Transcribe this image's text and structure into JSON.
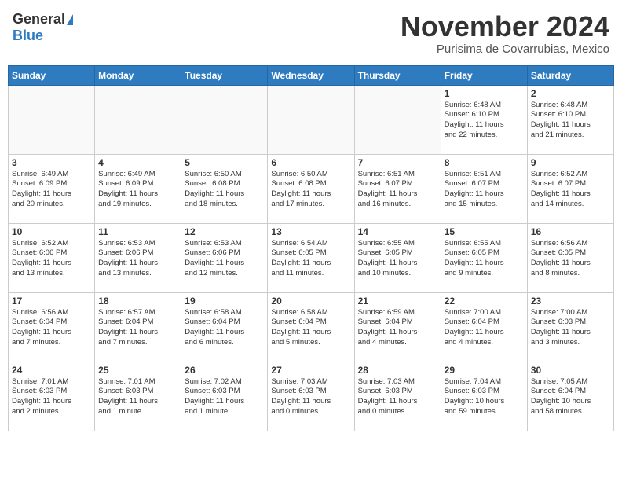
{
  "header": {
    "logo_general": "General",
    "logo_blue": "Blue",
    "title": "November 2024",
    "location": "Purisima de Covarrubias, Mexico"
  },
  "weekdays": [
    "Sunday",
    "Monday",
    "Tuesday",
    "Wednesday",
    "Thursday",
    "Friday",
    "Saturday"
  ],
  "weeks": [
    [
      {
        "day": "",
        "info": ""
      },
      {
        "day": "",
        "info": ""
      },
      {
        "day": "",
        "info": ""
      },
      {
        "day": "",
        "info": ""
      },
      {
        "day": "",
        "info": ""
      },
      {
        "day": "1",
        "info": "Sunrise: 6:48 AM\nSunset: 6:10 PM\nDaylight: 11 hours\nand 22 minutes."
      },
      {
        "day": "2",
        "info": "Sunrise: 6:48 AM\nSunset: 6:10 PM\nDaylight: 11 hours\nand 21 minutes."
      }
    ],
    [
      {
        "day": "3",
        "info": "Sunrise: 6:49 AM\nSunset: 6:09 PM\nDaylight: 11 hours\nand 20 minutes."
      },
      {
        "day": "4",
        "info": "Sunrise: 6:49 AM\nSunset: 6:09 PM\nDaylight: 11 hours\nand 19 minutes."
      },
      {
        "day": "5",
        "info": "Sunrise: 6:50 AM\nSunset: 6:08 PM\nDaylight: 11 hours\nand 18 minutes."
      },
      {
        "day": "6",
        "info": "Sunrise: 6:50 AM\nSunset: 6:08 PM\nDaylight: 11 hours\nand 17 minutes."
      },
      {
        "day": "7",
        "info": "Sunrise: 6:51 AM\nSunset: 6:07 PM\nDaylight: 11 hours\nand 16 minutes."
      },
      {
        "day": "8",
        "info": "Sunrise: 6:51 AM\nSunset: 6:07 PM\nDaylight: 11 hours\nand 15 minutes."
      },
      {
        "day": "9",
        "info": "Sunrise: 6:52 AM\nSunset: 6:07 PM\nDaylight: 11 hours\nand 14 minutes."
      }
    ],
    [
      {
        "day": "10",
        "info": "Sunrise: 6:52 AM\nSunset: 6:06 PM\nDaylight: 11 hours\nand 13 minutes."
      },
      {
        "day": "11",
        "info": "Sunrise: 6:53 AM\nSunset: 6:06 PM\nDaylight: 11 hours\nand 13 minutes."
      },
      {
        "day": "12",
        "info": "Sunrise: 6:53 AM\nSunset: 6:06 PM\nDaylight: 11 hours\nand 12 minutes."
      },
      {
        "day": "13",
        "info": "Sunrise: 6:54 AM\nSunset: 6:05 PM\nDaylight: 11 hours\nand 11 minutes."
      },
      {
        "day": "14",
        "info": "Sunrise: 6:55 AM\nSunset: 6:05 PM\nDaylight: 11 hours\nand 10 minutes."
      },
      {
        "day": "15",
        "info": "Sunrise: 6:55 AM\nSunset: 6:05 PM\nDaylight: 11 hours\nand 9 minutes."
      },
      {
        "day": "16",
        "info": "Sunrise: 6:56 AM\nSunset: 6:05 PM\nDaylight: 11 hours\nand 8 minutes."
      }
    ],
    [
      {
        "day": "17",
        "info": "Sunrise: 6:56 AM\nSunset: 6:04 PM\nDaylight: 11 hours\nand 7 minutes."
      },
      {
        "day": "18",
        "info": "Sunrise: 6:57 AM\nSunset: 6:04 PM\nDaylight: 11 hours\nand 7 minutes."
      },
      {
        "day": "19",
        "info": "Sunrise: 6:58 AM\nSunset: 6:04 PM\nDaylight: 11 hours\nand 6 minutes."
      },
      {
        "day": "20",
        "info": "Sunrise: 6:58 AM\nSunset: 6:04 PM\nDaylight: 11 hours\nand 5 minutes."
      },
      {
        "day": "21",
        "info": "Sunrise: 6:59 AM\nSunset: 6:04 PM\nDaylight: 11 hours\nand 4 minutes."
      },
      {
        "day": "22",
        "info": "Sunrise: 7:00 AM\nSunset: 6:04 PM\nDaylight: 11 hours\nand 4 minutes."
      },
      {
        "day": "23",
        "info": "Sunrise: 7:00 AM\nSunset: 6:03 PM\nDaylight: 11 hours\nand 3 minutes."
      }
    ],
    [
      {
        "day": "24",
        "info": "Sunrise: 7:01 AM\nSunset: 6:03 PM\nDaylight: 11 hours\nand 2 minutes."
      },
      {
        "day": "25",
        "info": "Sunrise: 7:01 AM\nSunset: 6:03 PM\nDaylight: 11 hours\nand 1 minute."
      },
      {
        "day": "26",
        "info": "Sunrise: 7:02 AM\nSunset: 6:03 PM\nDaylight: 11 hours\nand 1 minute."
      },
      {
        "day": "27",
        "info": "Sunrise: 7:03 AM\nSunset: 6:03 PM\nDaylight: 11 hours\nand 0 minutes."
      },
      {
        "day": "28",
        "info": "Sunrise: 7:03 AM\nSunset: 6:03 PM\nDaylight: 11 hours\nand 0 minutes."
      },
      {
        "day": "29",
        "info": "Sunrise: 7:04 AM\nSunset: 6:03 PM\nDaylight: 10 hours\nand 59 minutes."
      },
      {
        "day": "30",
        "info": "Sunrise: 7:05 AM\nSunset: 6:04 PM\nDaylight: 10 hours\nand 58 minutes."
      }
    ]
  ]
}
